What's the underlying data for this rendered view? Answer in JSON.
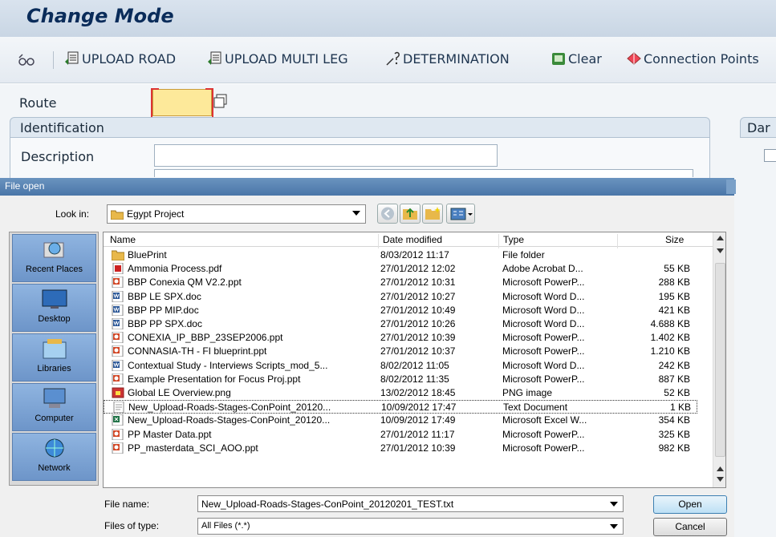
{
  "sap": {
    "title": "Change Mode",
    "toolbar": [
      {
        "label": "UPLOAD ROAD",
        "icon": "upload-icon"
      },
      {
        "label": "UPLOAD MULTI LEG",
        "icon": "upload-icon"
      },
      {
        "label": "DETERMINATION",
        "icon": "determination-icon"
      },
      {
        "label": "Clear",
        "icon": "clear-icon"
      },
      {
        "label": "Connection Points",
        "icon": "connection-icon"
      }
    ],
    "route_label": "Route",
    "identification_label": "Identification",
    "description_label": "Description",
    "date_group_label": "Dar"
  },
  "dialog": {
    "title": "File open",
    "look_in_label": "Look in:",
    "look_in_value": "Egypt Project",
    "places": [
      "Recent Places",
      "Desktop",
      "Libraries",
      "Computer",
      "Network"
    ],
    "columns": {
      "name": "Name",
      "date": "Date modified",
      "type": "Type",
      "size": "Size"
    },
    "files": [
      {
        "name": "BluePrint",
        "date": "8/03/2012 11:17",
        "type": "File folder",
        "size": "",
        "icon": "folder"
      },
      {
        "name": "Ammonia Process.pdf",
        "date": "27/01/2012 12:02",
        "type": "Adobe Acrobat D...",
        "size": "55 KB",
        "icon": "pdf"
      },
      {
        "name": "BBP Conexia QM V2.2.ppt",
        "date": "27/01/2012 10:31",
        "type": "Microsoft PowerP...",
        "size": "288 KB",
        "icon": "ppt"
      },
      {
        "name": "BBP LE SPX.doc",
        "date": "27/01/2012 10:27",
        "type": "Microsoft Word D...",
        "size": "195 KB",
        "icon": "doc"
      },
      {
        "name": "BBP PP MIP.doc",
        "date": "27/01/2012 10:49",
        "type": "Microsoft Word D...",
        "size": "421 KB",
        "icon": "doc"
      },
      {
        "name": "BBP PP SPX.doc",
        "date": "27/01/2012 10:26",
        "type": "Microsoft Word D...",
        "size": "4.688 KB",
        "icon": "doc"
      },
      {
        "name": "CONEXIA_IP_BBP_23SEP2006.ppt",
        "date": "27/01/2012 10:39",
        "type": "Microsoft PowerP...",
        "size": "1.402 KB",
        "icon": "ppt"
      },
      {
        "name": "CONNASIA-TH - FI blueprint.ppt",
        "date": "27/01/2012 10:37",
        "type": "Microsoft PowerP...",
        "size": "1.210 KB",
        "icon": "ppt"
      },
      {
        "name": "Contextual Study - Interviews Scripts_mod_5...",
        "date": "8/02/2012 11:05",
        "type": "Microsoft Word D...",
        "size": "242 KB",
        "icon": "doc"
      },
      {
        "name": "Example Presentation for Focus Proj.ppt",
        "date": "8/02/2012 11:35",
        "type": "Microsoft PowerP...",
        "size": "887 KB",
        "icon": "ppt"
      },
      {
        "name": "Global LE Overview.png",
        "date": "13/02/2012 18:45",
        "type": "PNG image",
        "size": "52 KB",
        "icon": "png"
      },
      {
        "name": "New_Upload-Roads-Stages-ConPoint_20120...",
        "date": "10/09/2012 17:47",
        "type": "Text Document",
        "size": "1 KB",
        "icon": "txt",
        "selected": true
      },
      {
        "name": "New_Upload-Roads-Stages-ConPoint_20120...",
        "date": "10/09/2012 17:49",
        "type": "Microsoft Excel W...",
        "size": "354 KB",
        "icon": "xls"
      },
      {
        "name": "PP Master Data.ppt",
        "date": "27/01/2012 11:17",
        "type": "Microsoft PowerP...",
        "size": "325 KB",
        "icon": "ppt"
      },
      {
        "name": "PP_masterdata_SCI_AOO.ppt",
        "date": "27/01/2012 10:39",
        "type": "Microsoft PowerP...",
        "size": "982 KB",
        "icon": "ppt"
      }
    ],
    "file_name_label": "File name:",
    "file_name_value": "New_Upload-Roads-Stages-ConPoint_20120201_TEST.txt",
    "file_type_label": "Files of type:",
    "file_type_value": "All Files (*.*)",
    "open_label": "Open",
    "cancel_label": "Cancel"
  }
}
